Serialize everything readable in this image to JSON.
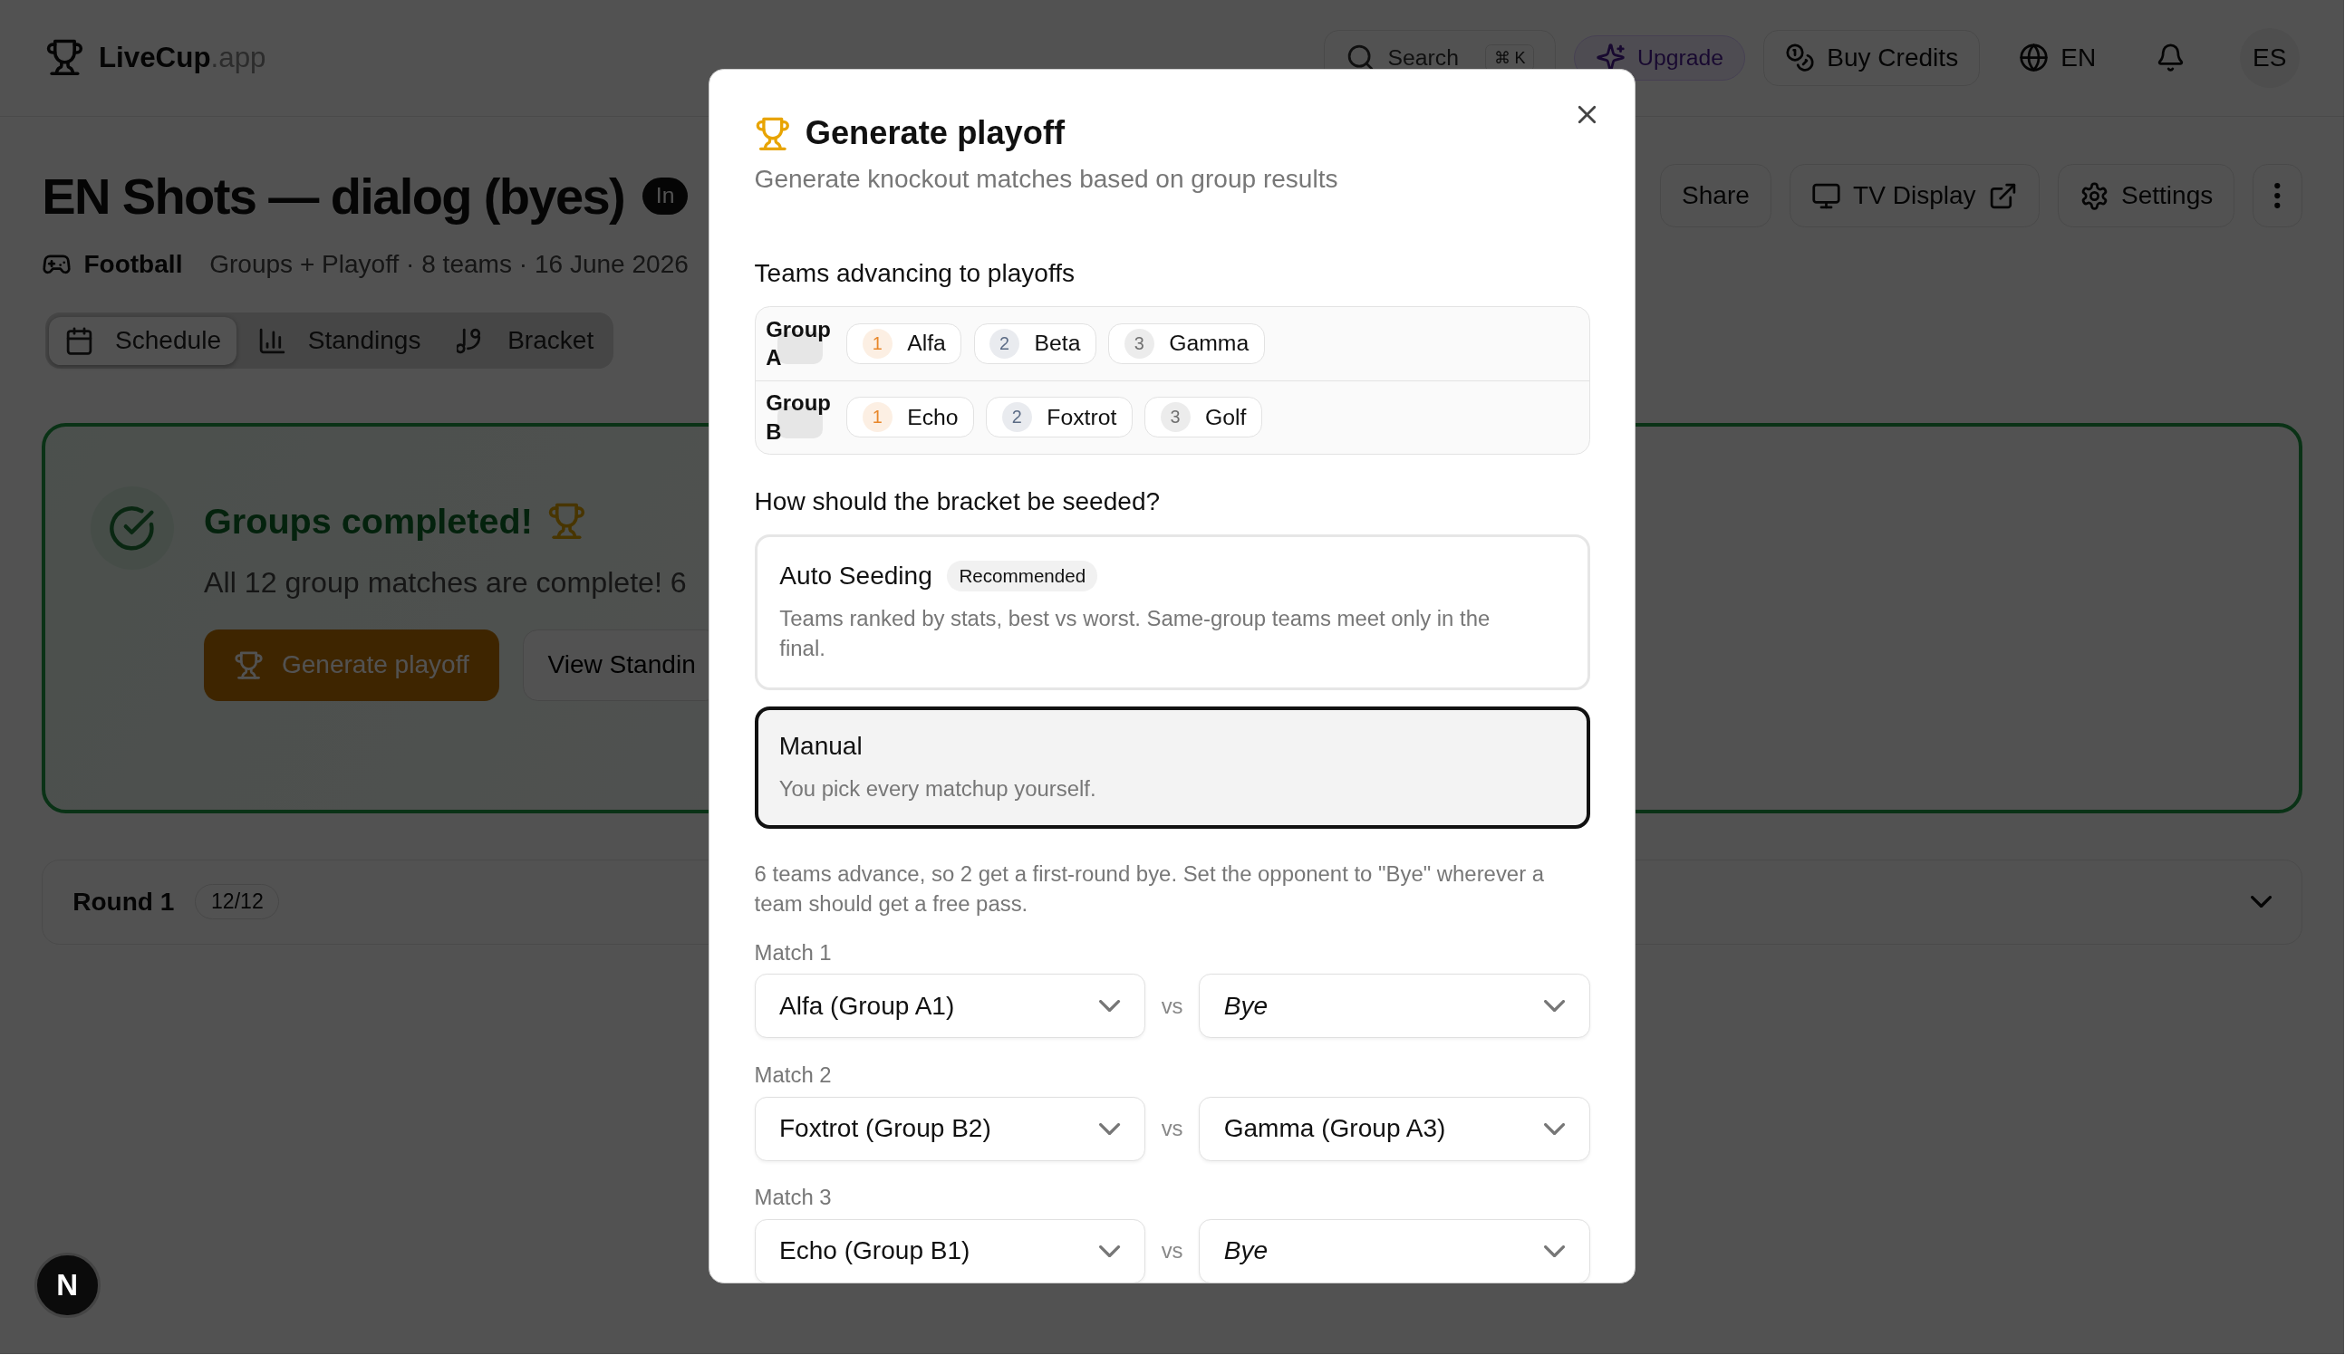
{
  "topbar": {
    "brand": "LiveCup",
    "brand_suffix": ".app",
    "search": "Search",
    "search_shortcut": "⌘ K",
    "upgrade": "Upgrade",
    "buy_credits": "Buy Credits",
    "language": "EN",
    "avatar": "ES"
  },
  "header": {
    "title": "EN Shots — dialog (byes)",
    "status_badge": "In",
    "sport": "Football",
    "meta": "Groups + Playoff · 8 teams · 16 June 2026",
    "actions": [
      {
        "label": "Share",
        "kind": "plain"
      },
      {
        "label": "TV Display",
        "kind": "tv"
      },
      {
        "label": "Settings",
        "kind": "settings"
      }
    ]
  },
  "tabs": [
    {
      "label": "Schedule",
      "kind": "calendar",
      "selected": true
    },
    {
      "label": "Standings",
      "kind": "chart",
      "selected": false
    },
    {
      "label": "Bracket",
      "kind": "branch",
      "selected": false
    }
  ],
  "banner": {
    "title": "Groups completed!",
    "text": "All 12 group matches are complete! 6",
    "primary": "Generate playoff",
    "secondary": "View Standin"
  },
  "rounds": [
    {
      "name": "Round 1",
      "count": "12/12"
    }
  ],
  "dev_badge": "N",
  "dialog": {
    "title": "Generate playoff",
    "subtitle": "Generate knockout matches based on group results",
    "teams_heading": "Teams advancing to playoffs",
    "groups": [
      {
        "name": "Group A",
        "teams": [
          {
            "rank": "1",
            "name": "Alfa",
            "color": "#e8872a"
          },
          {
            "rank": "2",
            "name": "Beta",
            "color": "#5b6b85"
          },
          {
            "rank": "3",
            "name": "Gamma",
            "color": "#707070"
          }
        ]
      },
      {
        "name": "Group B",
        "teams": [
          {
            "rank": "1",
            "name": "Echo",
            "color": "#e8872a"
          },
          {
            "rank": "2",
            "name": "Foxtrot",
            "color": "#5b6b85"
          },
          {
            "rank": "3",
            "name": "Golf",
            "color": "#707070"
          }
        ]
      }
    ],
    "seeding_heading": "How should the bracket be seeded?",
    "options": [
      {
        "title": "Auto Seeding",
        "badge": "Recommended",
        "description": "Teams ranked by stats, best vs worst. Same-group teams meet only in the final.",
        "selected": false
      },
      {
        "title": "Manual",
        "description": "You pick every matchup yourself.",
        "selected": true
      }
    ],
    "note": "6 teams advance, so 2 get a first-round bye. Set the opponent to \"Bye\" wherever a team should get a free pass.",
    "matches": [
      {
        "label": "Match 1",
        "home": {
          "value": "Alfa (Group A1)",
          "kind": "team"
        },
        "vs": "vs",
        "away": {
          "value": "Bye",
          "kind": "bye"
        }
      },
      {
        "label": "Match 2",
        "home": {
          "value": "Foxtrot (Group B2)",
          "kind": "team"
        },
        "vs": "vs",
        "away": {
          "value": "Gamma (Group A3)",
          "kind": "team"
        }
      },
      {
        "label": "Match 3",
        "home": {
          "value": "Echo (Group B1)",
          "kind": "team"
        },
        "vs": "vs",
        "away": {
          "value": "Bye",
          "kind": "bye"
        }
      }
    ]
  }
}
